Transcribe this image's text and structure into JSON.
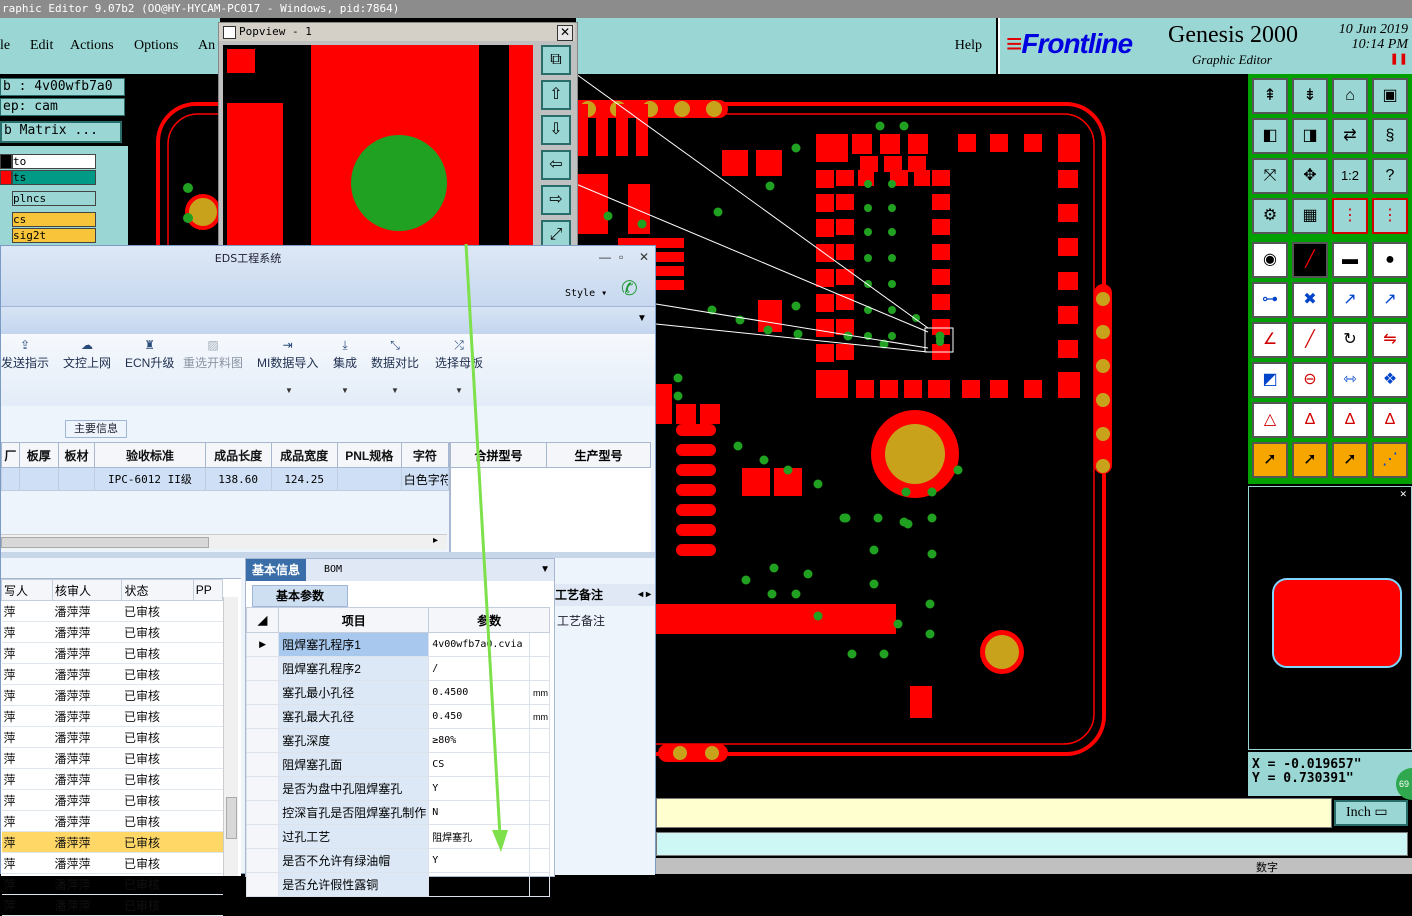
{
  "genesis": {
    "title_bar": "raphic Editor 9.07b2 (OO@HY-HYCAM-PC017 - Windows, pid:7864)",
    "menu": [
      "le",
      "Edit",
      "Actions",
      "Options",
      "An"
    ],
    "help_label": "Help",
    "logo_text": "Frontline",
    "app_name": "Genesis 2000",
    "app_sub": "Graphic Editor",
    "date": "10 Jun 2019",
    "time": "10:14 PM",
    "job_label": "b : 4v00wfb7a0",
    "step_label": "ep: cam",
    "matrix_label": "b Matrix ...",
    "layers": [
      {
        "name": "to",
        "bg": "#ffffff"
      },
      {
        "name": "ts",
        "bg": "#009a86"
      },
      {
        "name": "plncs",
        "bg": "#9ad6d3"
      },
      {
        "name": "cs",
        "bg": "#f7c43a"
      },
      {
        "name": "sig2t",
        "bg": "#f7c43a"
      }
    ],
    "popview_title": "Popview - 1",
    "coords_x": "X = -0.019657\"",
    "coords_y": "Y = 0.730391\"",
    "units": "Inch",
    "status_text": "数字",
    "colors": {
      "pad": "#ff0000",
      "via": "#21a121",
      "drill": "#c9a21c",
      "teal": "#9ad6d3"
    }
  },
  "eds": {
    "title": "EDS工程系统",
    "style_label": "Style",
    "ribbon": [
      {
        "label": "发送指示",
        "icon": "upload-icon",
        "disabled": false
      },
      {
        "label": "文控上网",
        "icon": "cloud-icon",
        "disabled": false
      },
      {
        "label": "ECN升级",
        "icon": "ecn-icon",
        "disabled": false
      },
      {
        "label": "重选开料图",
        "icon": "image-icon",
        "disabled": true
      },
      {
        "label": "MI数据导入",
        "icon": "import-icon",
        "disabled": false
      },
      {
        "label": "集成",
        "icon": "download-icon",
        "disabled": false
      },
      {
        "label": "数据对比",
        "icon": "compare-icon",
        "disabled": false
      },
      {
        "label": "选择母板",
        "icon": "shuffle-icon",
        "disabled": false
      }
    ],
    "main_info_label": "主要信息",
    "main_table": {
      "headers": [
        "厂",
        "板厚",
        "板材",
        "验收标准",
        "成品长度",
        "成品宽度",
        "PNL规格",
        "字符"
      ],
      "row": [
        "",
        "",
        "",
        "IPC-6012 II级",
        "138.60",
        "124.25",
        "",
        "白色字符"
      ]
    },
    "model_headers": [
      "合拼型号",
      "生产型号"
    ],
    "list_table": {
      "headers": [
        "写人",
        "核审人",
        "状态",
        "PP"
      ],
      "rows": [
        [
          "萍",
          "潘萍萍",
          "已审核"
        ],
        [
          "萍",
          "潘萍萍",
          "已审核"
        ],
        [
          "萍",
          "潘萍萍",
          "已审核"
        ],
        [
          "萍",
          "潘萍萍",
          "已审核"
        ],
        [
          "萍",
          "潘萍萍",
          "已审核"
        ],
        [
          "萍",
          "潘萍萍",
          "已审核"
        ],
        [
          "萍",
          "潘萍萍",
          "已审核"
        ],
        [
          "萍",
          "潘萍萍",
          "已审核"
        ],
        [
          "萍",
          "潘萍萍",
          "已审核"
        ],
        [
          "萍",
          "潘萍萍",
          "已审核"
        ],
        [
          "萍",
          "潘萍萍",
          "已审核"
        ],
        [
          "萍",
          "潘萍萍",
          "已审核"
        ],
        [
          "萍",
          "潘萍萍",
          "已审核"
        ],
        [
          "萍",
          "潘萍萍",
          "已审核"
        ],
        [
          "萍",
          "潘萍萍",
          "已审核"
        ]
      ],
      "selected_index": 11
    },
    "tabs": [
      "基本信息",
      "BOM"
    ],
    "sub_tab": "基本参数",
    "params_headers": [
      "项目",
      "参数"
    ],
    "params": [
      {
        "item": "阻焊塞孔程序1",
        "value": "4v00wfb7a0.cvia",
        "unit": ""
      },
      {
        "item": "阻焊塞孔程序2",
        "value": "/",
        "unit": ""
      },
      {
        "item": "塞孔最小孔径",
        "value": "0.4500",
        "unit": "mm"
      },
      {
        "item": "塞孔最大孔径",
        "value": "0.450",
        "unit": "mm"
      },
      {
        "item": "塞孔深度",
        "value": "≥80%",
        "unit": ""
      },
      {
        "item": "阻焊塞孔面",
        "value": "CS",
        "unit": ""
      },
      {
        "item": "是否为盘中孔阻焊塞孔",
        "value": "Y",
        "unit": ""
      },
      {
        "item": "控深盲孔是否阻焊塞孔制作",
        "value": "N",
        "unit": ""
      },
      {
        "item": "过孔工艺",
        "value": "阻焊塞孔",
        "unit": ""
      },
      {
        "item": "是否不允许有绿油帽",
        "value": "Y",
        "unit": ""
      },
      {
        "item": "是否允许假性露铜",
        "value": "/",
        "unit": ""
      }
    ],
    "craft_tab": "工艺备注",
    "craft_label": "工艺备注"
  }
}
